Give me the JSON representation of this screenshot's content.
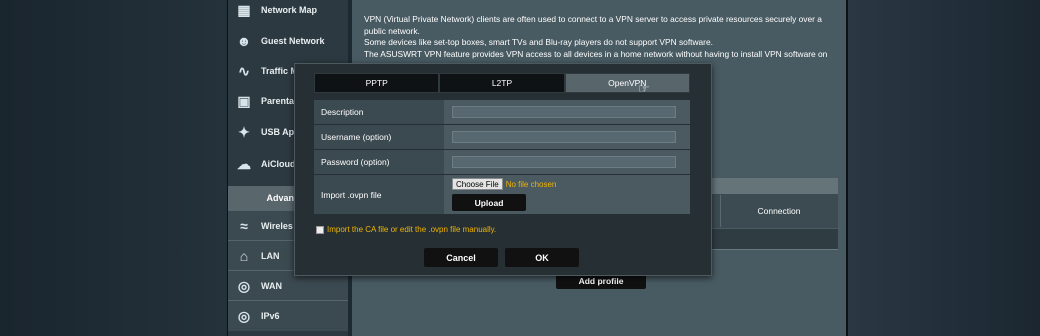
{
  "sidebar": {
    "items": [
      {
        "label": "Network Map",
        "icon": "network-map-icon"
      },
      {
        "label": "Guest Network",
        "icon": "guest-network-icon"
      },
      {
        "label": "Traffic M",
        "icon": "traffic-manager-icon"
      },
      {
        "label": "Parental",
        "icon": "parental-lock-icon"
      },
      {
        "label": "USB Ap",
        "icon": "usb-puzzle-icon"
      },
      {
        "label": "AiCloud",
        "icon": "aicloud-icon"
      }
    ],
    "advanced_header": "Advanced",
    "advanced_items": [
      {
        "label": "Wireles",
        "icon": "wireless-icon"
      },
      {
        "label": "LAN",
        "icon": "lan-home-icon"
      },
      {
        "label": "WAN",
        "icon": "wan-globe-icon"
      },
      {
        "label": "IPv6",
        "icon": "ipv6-globe-icon"
      }
    ]
  },
  "content": {
    "intro_lines": [
      "VPN (Virtual Private Network) clients are often used to connect to a VPN server to access private resources securely over a",
      "public network.",
      "Some devices like set-top boxes, smart TVs and Blu-ray players do not support VPN software.",
      "The ASUSWRT VPN feature provides VPN access to all devices in a home network without having to install VPN software on"
    ],
    "table": {
      "connection_header": "Connection"
    },
    "add_profile_label": "Add profile"
  },
  "modal": {
    "tabs": [
      {
        "label": "PPTP",
        "active": false
      },
      {
        "label": "L2TP",
        "active": false
      },
      {
        "label": "OpenVPN",
        "active": true
      }
    ],
    "fields": [
      {
        "label": "Description",
        "value": ""
      },
      {
        "label": "Username (option)",
        "value": ""
      },
      {
        "label": "Password (option)",
        "value": ""
      }
    ],
    "import_label": "Import .ovpn file",
    "choose_file_label": "Choose File",
    "no_file_text": "No file chosen",
    "upload_label": "Upload",
    "ca_checkbox_label": "Import the CA file or edit the .ovpn file manually.",
    "cancel_label": "Cancel",
    "ok_label": "OK"
  },
  "colors": {
    "accent_warning": "#f0b400",
    "active_tab": "#58666c",
    "panel": "#485a62"
  }
}
